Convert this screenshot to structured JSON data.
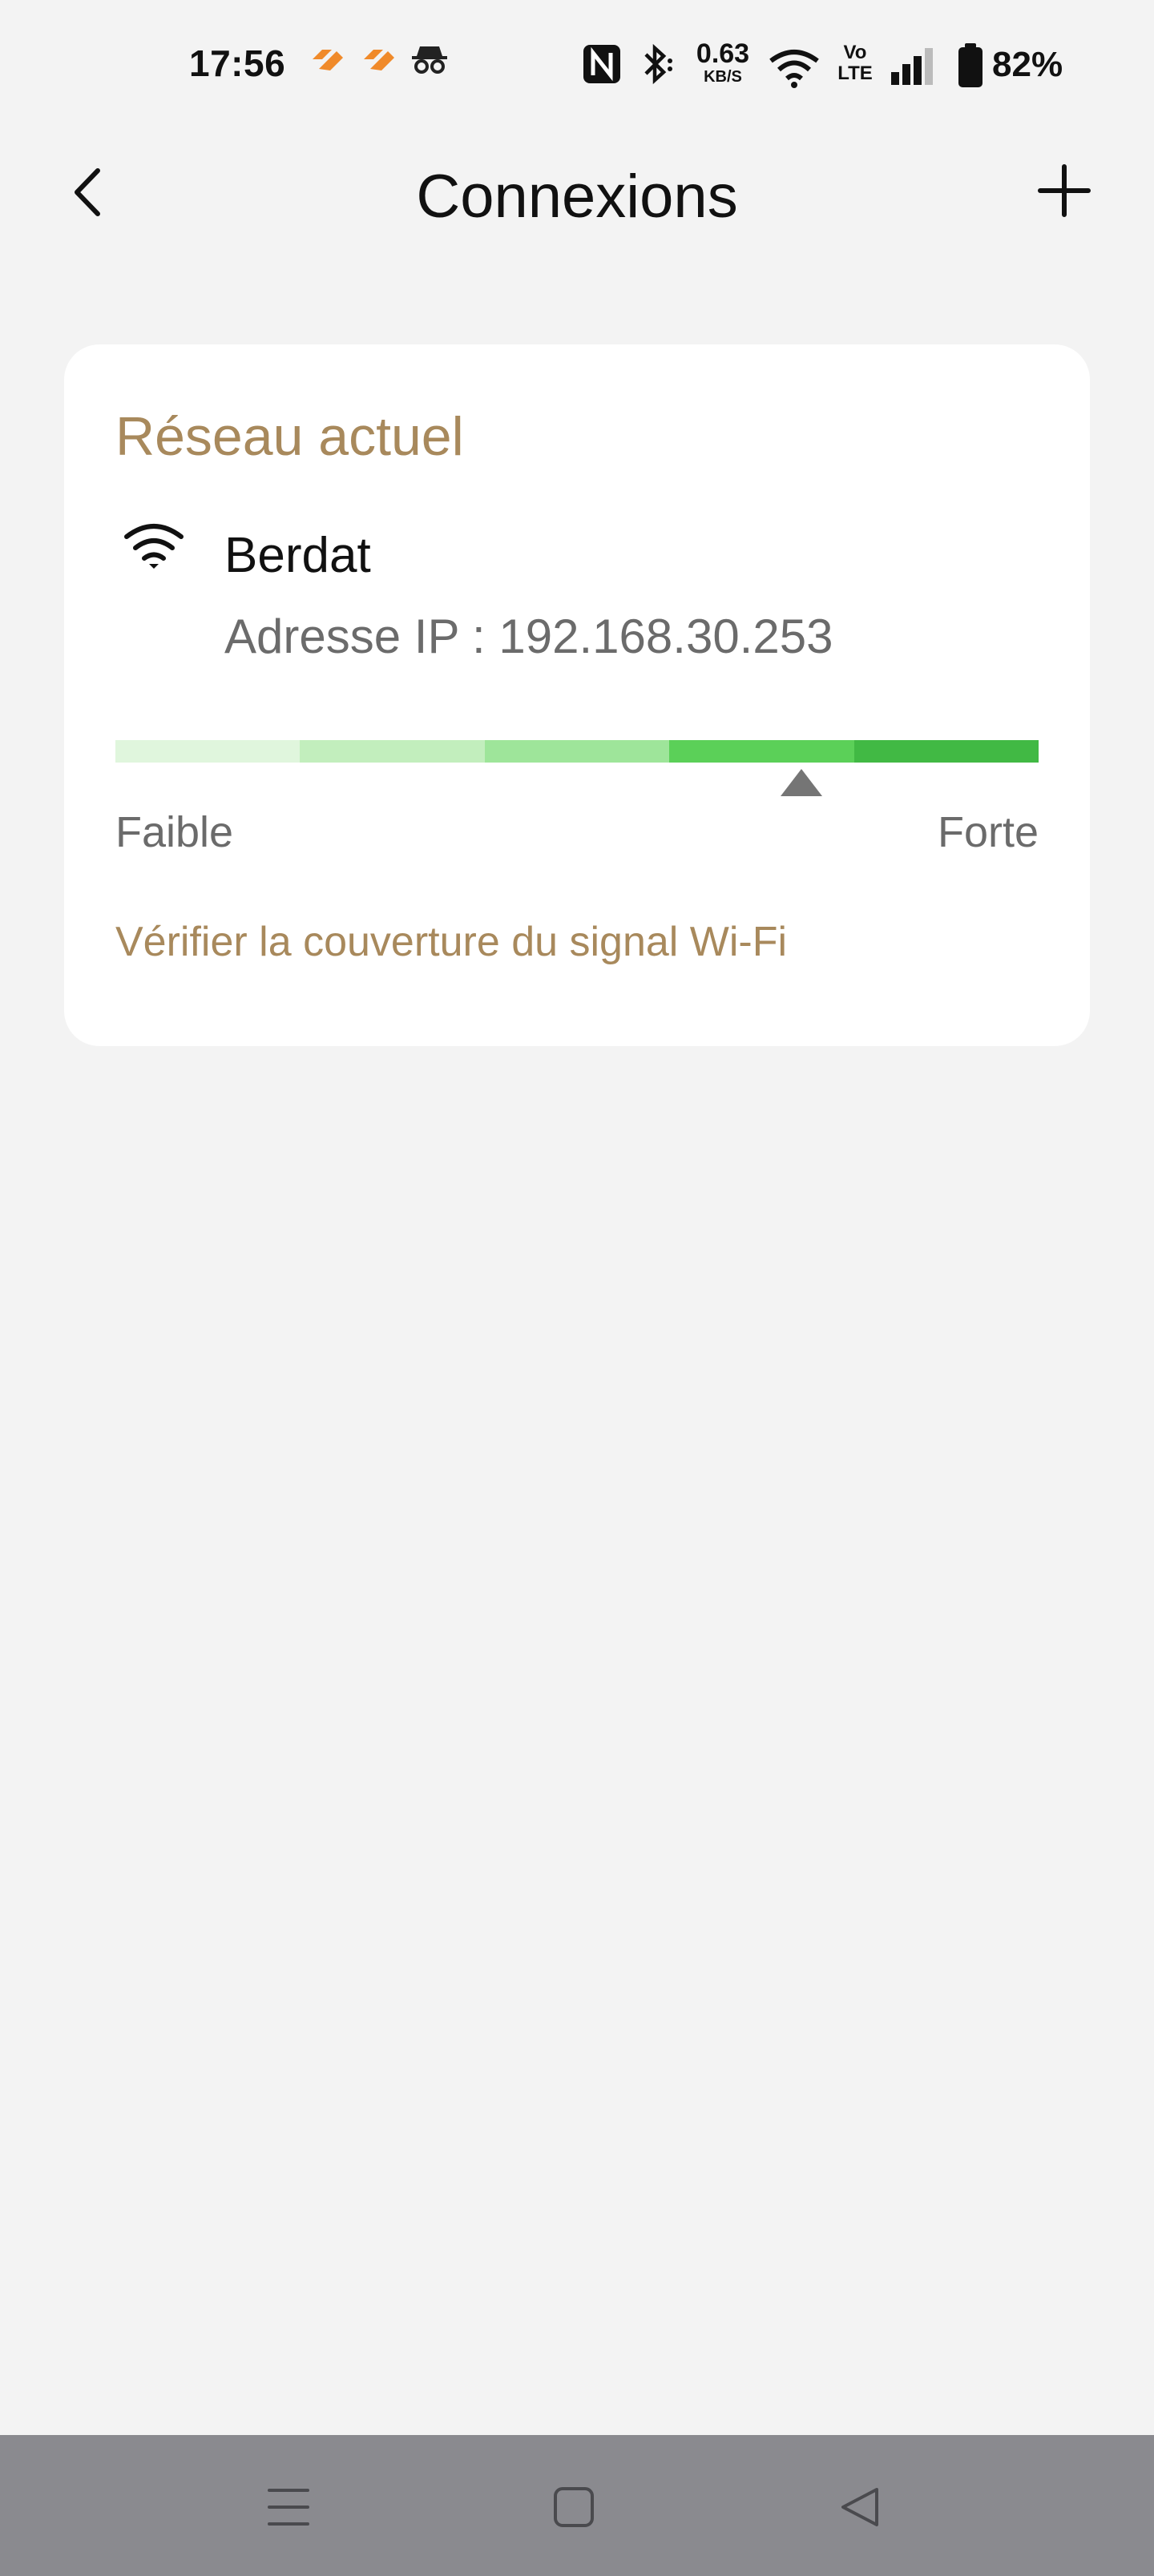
{
  "status_bar": {
    "time": "17:56",
    "network_speed_value": "0.63",
    "network_speed_unit": "KB/S",
    "volte_top": "Vo",
    "volte_bottom": "LTE",
    "battery_percent": "82%",
    "notification_icons": [
      "app-notification-icon",
      "app-notification-icon",
      "incognito-icon"
    ],
    "right_icons": [
      "nfc-icon",
      "bluetooth-icon",
      "wifi-icon",
      "volte-icon",
      "cell-signal-icon",
      "battery-icon"
    ]
  },
  "header": {
    "title": "Connexions",
    "back_icon": "chevron-left-icon",
    "add_icon": "plus-icon"
  },
  "current_network": {
    "section_title": "Réseau actuel",
    "name": "Berdat",
    "ip_line": "Adresse IP : 192.168.30.253",
    "signal_strength_fraction": 0.743,
    "signal_segments": 5,
    "segment_colors": [
      "#e0f6dd",
      "#c2eebd",
      "#9ee59a",
      "#5bd058",
      "#41b944"
    ],
    "label_weak": "Faible",
    "label_strong": "Forte",
    "check_link": "Vérifier la couverture du signal Wi-Fi"
  },
  "colors": {
    "accent": "#a8895c",
    "background": "#f3f3f3",
    "card": "#ffffff",
    "nav_bar": "#8a8a8f"
  },
  "nav": {
    "icons": [
      "menu-icon",
      "home-square-icon",
      "back-triangle-icon"
    ]
  }
}
